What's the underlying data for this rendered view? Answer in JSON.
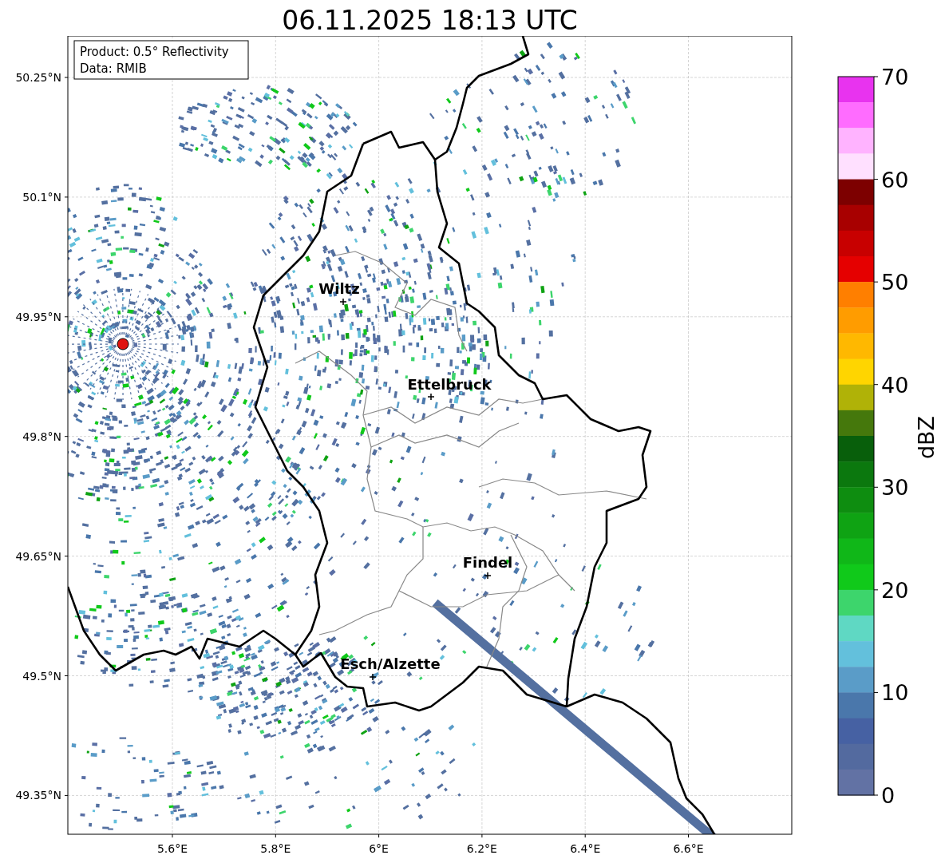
{
  "title": "06.11.2025 18:13 UTC",
  "info_box": {
    "lines": [
      "Product: 0.5° Reflectivity",
      "Data: RMIB"
    ]
  },
  "map": {
    "lat_ticks": [
      "50.25°N",
      "50.1°N",
      "49.95°N",
      "49.8°N",
      "49.65°N",
      "49.5°N",
      "49.35°N"
    ],
    "lon_ticks": [
      "5.6°E",
      "5.8°E",
      "6°E",
      "6.2°E",
      "6.4°E",
      "6.6°E"
    ],
    "places": [
      {
        "name": "Wiltz"
      },
      {
        "name": "Ettelbruck"
      },
      {
        "name": "Findel"
      },
      {
        "name": "Esch/Alzette"
      }
    ]
  },
  "colorbar": {
    "label": "dBZ",
    "ticks": [
      "70",
      "60",
      "50",
      "40",
      "30",
      "20",
      "10",
      "0"
    ],
    "bands": [
      {
        "color": "#e833ef"
      },
      {
        "color": "#ff6cff"
      },
      {
        "color": "#ffb3ff"
      },
      {
        "color": "#ffe0ff"
      },
      {
        "color": "#7d0000"
      },
      {
        "color": "#a80000"
      },
      {
        "color": "#c80000"
      },
      {
        "color": "#e50000"
      },
      {
        "color": "#ff7f00"
      },
      {
        "color": "#ff9c00"
      },
      {
        "color": "#ffb800"
      },
      {
        "color": "#ffd500"
      },
      {
        "color": "#b0b207"
      },
      {
        "color": "#45780c"
      },
      {
        "color": "#085f0b"
      },
      {
        "color": "#0b780e"
      },
      {
        "color": "#0e8d10"
      },
      {
        "color": "#0fa313"
      },
      {
        "color": "#10b718"
      },
      {
        "color": "#10c91a"
      },
      {
        "color": "#3dd56c"
      },
      {
        "color": "#5fd8c3"
      },
      {
        "color": "#63c0dc"
      },
      {
        "color": "#5a9cc8"
      },
      {
        "color": "#4a77ab"
      },
      {
        "color": "#4661a3"
      },
      {
        "color": "#536a9f"
      },
      {
        "color": "#6272a4"
      }
    ]
  }
}
